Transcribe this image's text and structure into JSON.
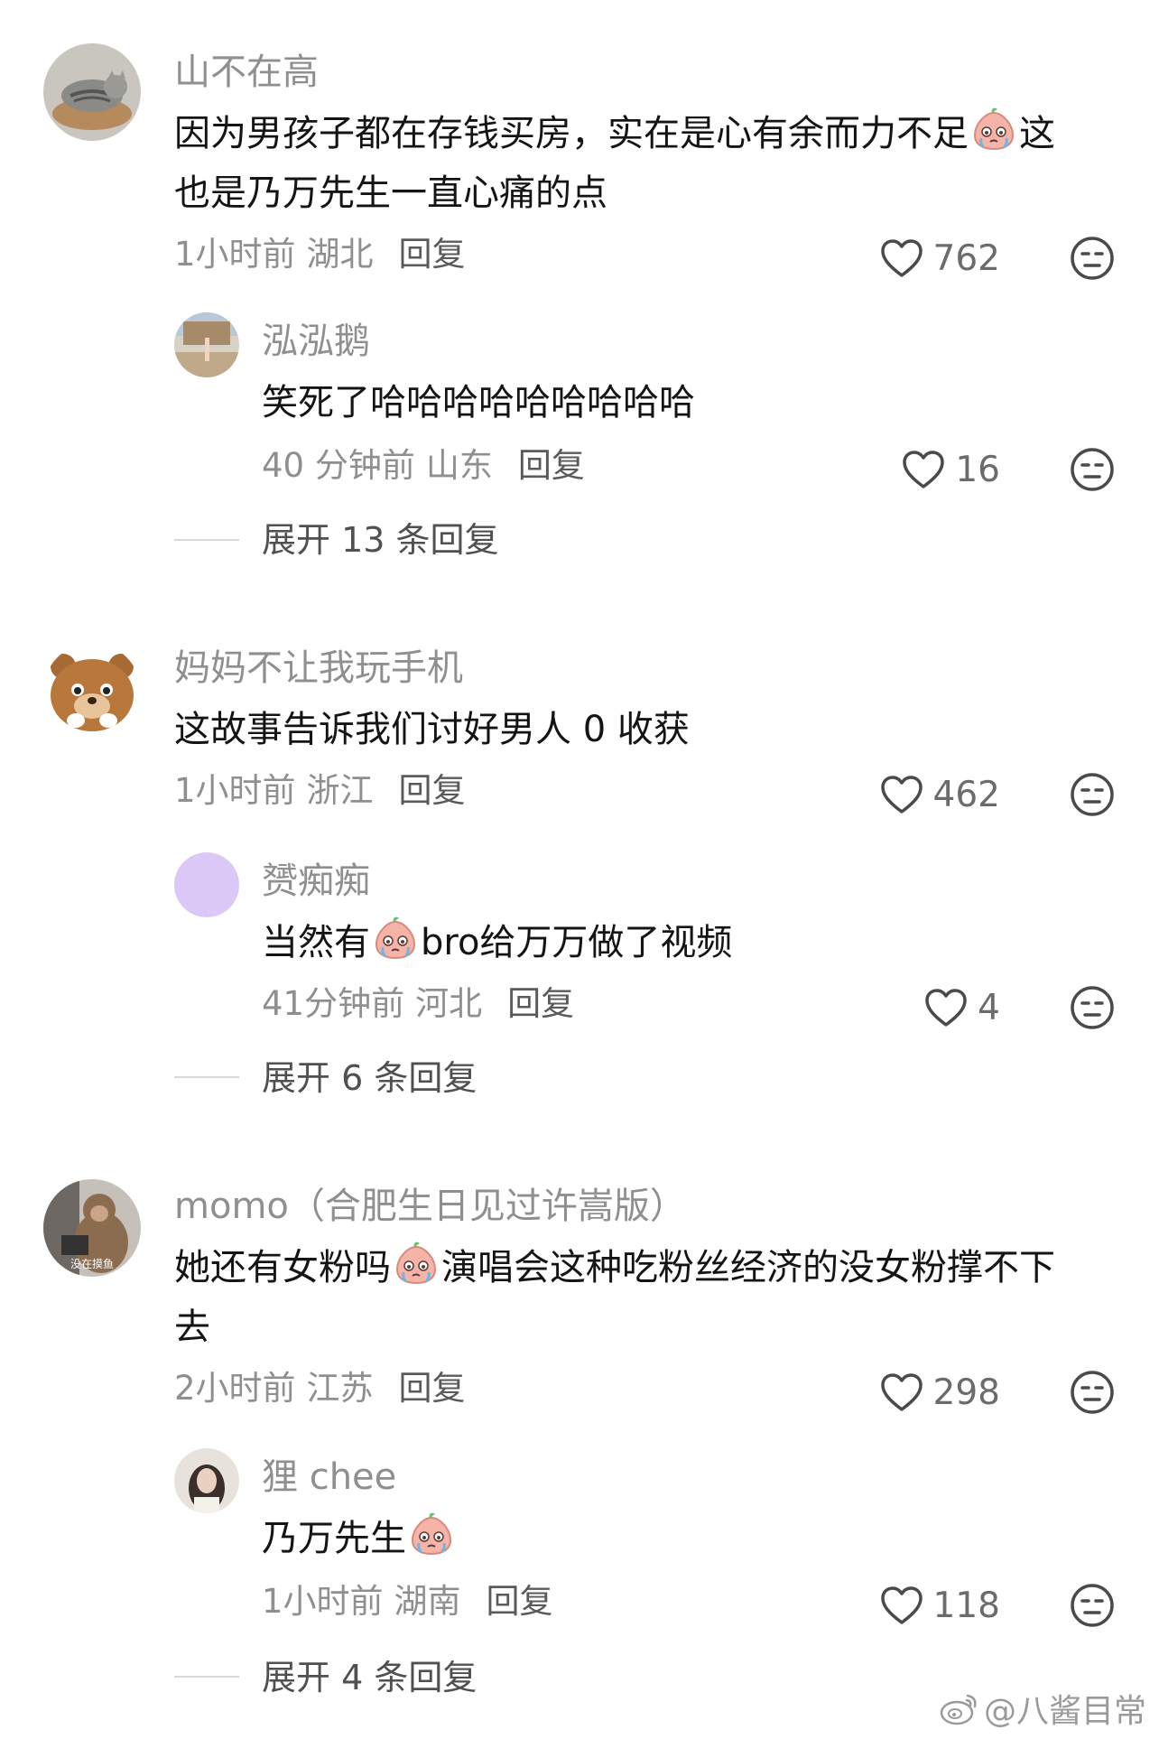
{
  "threads": [
    {
      "username": "山不在高",
      "text_line1_before": "因为男孩子都在存钱买房，实在是心有余而力不足",
      "text_line1_after": "这",
      "text_line2": "也是乃万先生一直心痛的点",
      "time": "1小时前",
      "location": "湖北",
      "reply_label": "回复",
      "likes": "762",
      "reply": {
        "username": "泓泓鹅",
        "text": "笑死了哈哈哈哈哈哈哈哈哈",
        "time": "40 分钟前",
        "location": "山东",
        "reply_label": "回复",
        "likes": "16"
      },
      "expand_label": "展开 13 条回复"
    },
    {
      "username": "妈妈不让我玩手机",
      "text_line1": "这故事告诉我们讨好男人 0 收获",
      "time": "1小时前",
      "location": "浙江",
      "reply_label": "回复",
      "likes": "462",
      "reply": {
        "username": "赟痴痴",
        "text_before": "当然有",
        "text_after": "bro给万万做了视频",
        "time": "41分钟前",
        "location": "河北",
        "reply_label": "回复",
        "likes": "4"
      },
      "expand_label": "展开 6 条回复"
    },
    {
      "username": "momo（合肥生日见过许嵩版）",
      "avatar_caption": "没在摸鱼",
      "text_line1_before": "她还有女粉吗",
      "text_line1_after": "演唱会这种吃粉丝经济的没女粉撑不下",
      "text_line2": "去",
      "time": "2小时前",
      "location": "江苏",
      "reply_label": "回复",
      "likes": "298",
      "reply": {
        "username": "狸 chee",
        "text_before": "乃万先生",
        "time": "1小时前",
        "location": "湖南",
        "reply_label": "回复",
        "likes": "118"
      },
      "expand_label": "展开 4 条回复"
    }
  ],
  "watermark": "@八酱目常",
  "icons": {
    "like": "heart-outline-icon",
    "dislike": "neutral-face-icon",
    "emoji": "crying-peach-emoji",
    "watermark_logo": "weibo-logo"
  },
  "colors": {
    "username": "#8f8f8f",
    "text": "#141414",
    "meta": "#8f8f8f",
    "icon": "#4a4a4a",
    "emoji_peach": "#f6b3a8"
  }
}
